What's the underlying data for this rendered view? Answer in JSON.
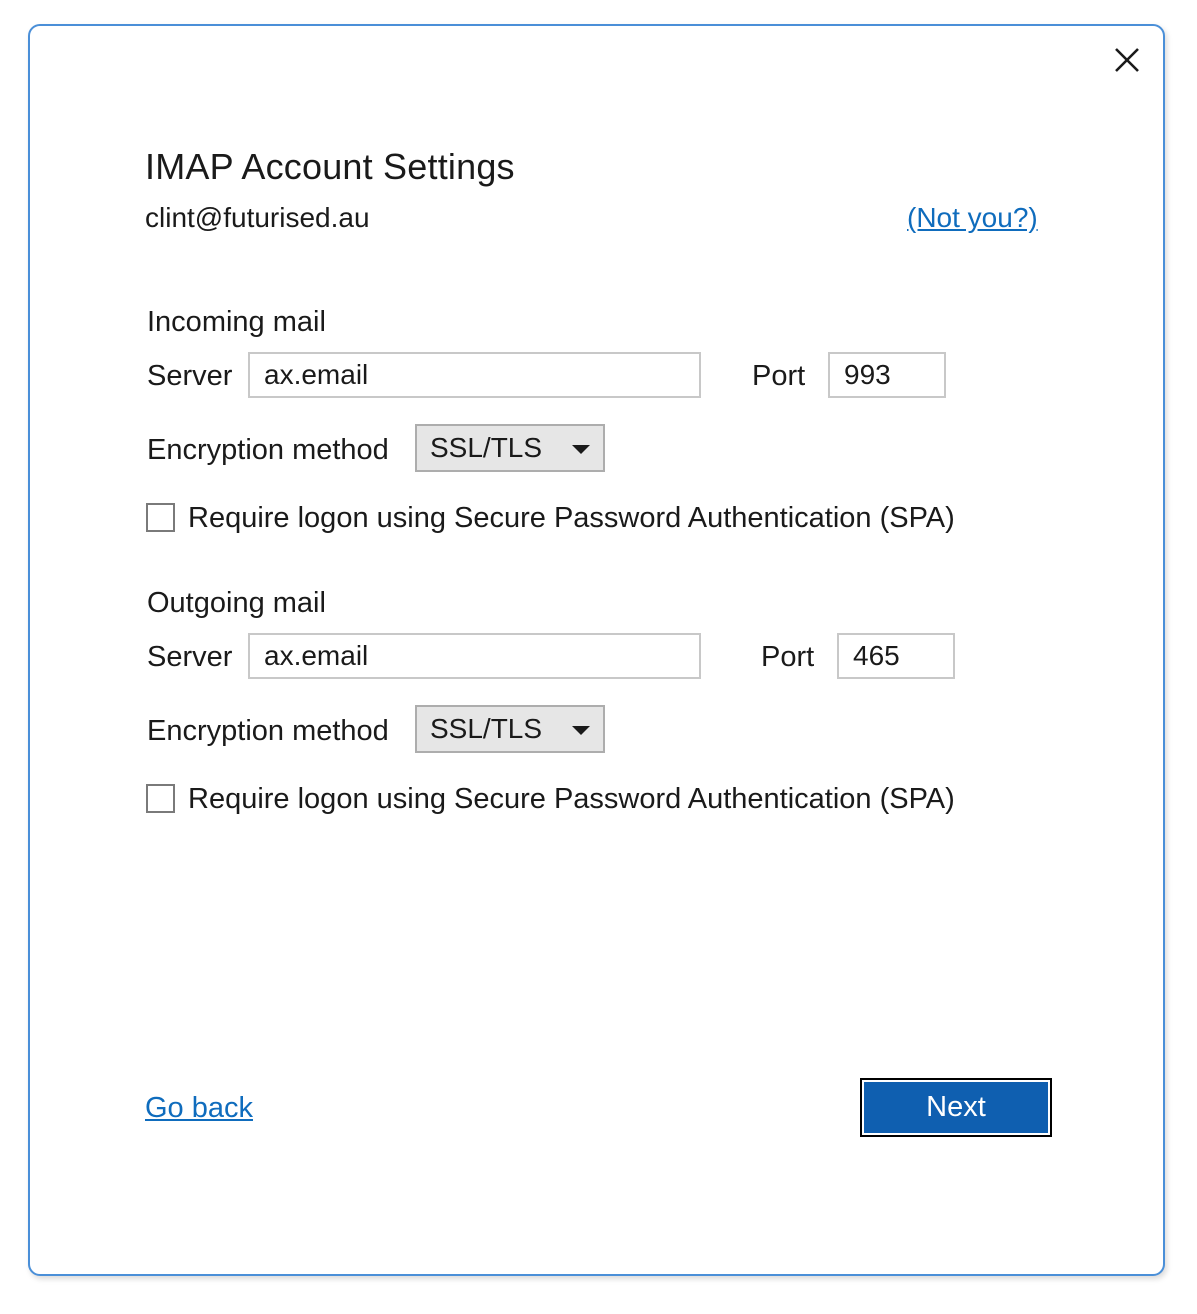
{
  "dialog": {
    "title": "IMAP Account Settings",
    "account_email": "clint@futurised.au",
    "not_you_link": "(Not you?)"
  },
  "incoming": {
    "section_label": "Incoming mail",
    "server_label": "Server",
    "server_value": "ax.email",
    "port_label": "Port",
    "port_value": "993",
    "encryption_label": "Encryption method",
    "encryption_value": "SSL/TLS",
    "spa_checked": false,
    "spa_label": "Require logon using Secure Password Authentication (SPA)"
  },
  "outgoing": {
    "section_label": "Outgoing mail",
    "server_label": "Server",
    "server_value": "ax.email",
    "port_label": "Port",
    "port_value": "465",
    "encryption_label": "Encryption method",
    "encryption_value": "SSL/TLS",
    "spa_checked": false,
    "spa_label": "Require logon using Secure Password Authentication (SPA)"
  },
  "footer": {
    "go_back_link": "Go back",
    "next_button": "Next"
  },
  "colors": {
    "accent": "#0f6cbd",
    "primary_button": "#0f5fb0",
    "dialog_border": "#4a8fd8"
  },
  "icons": {
    "close": "close-icon",
    "dropdown": "chevron-down-icon"
  }
}
